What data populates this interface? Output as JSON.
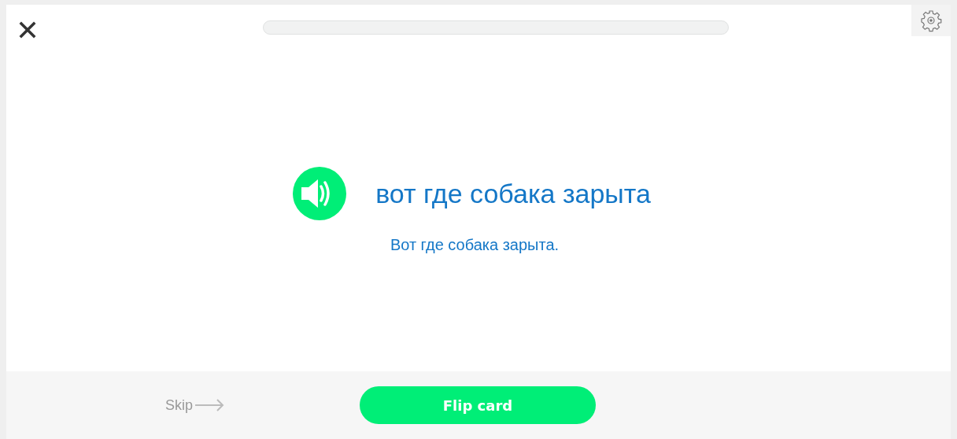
{
  "progress": {
    "level": 0
  },
  "card": {
    "term": "вот где собака зарыта",
    "definition": "Вот где собака зарыта."
  },
  "footer": {
    "skip": "Skip",
    "flip_button": "Flip card"
  }
}
